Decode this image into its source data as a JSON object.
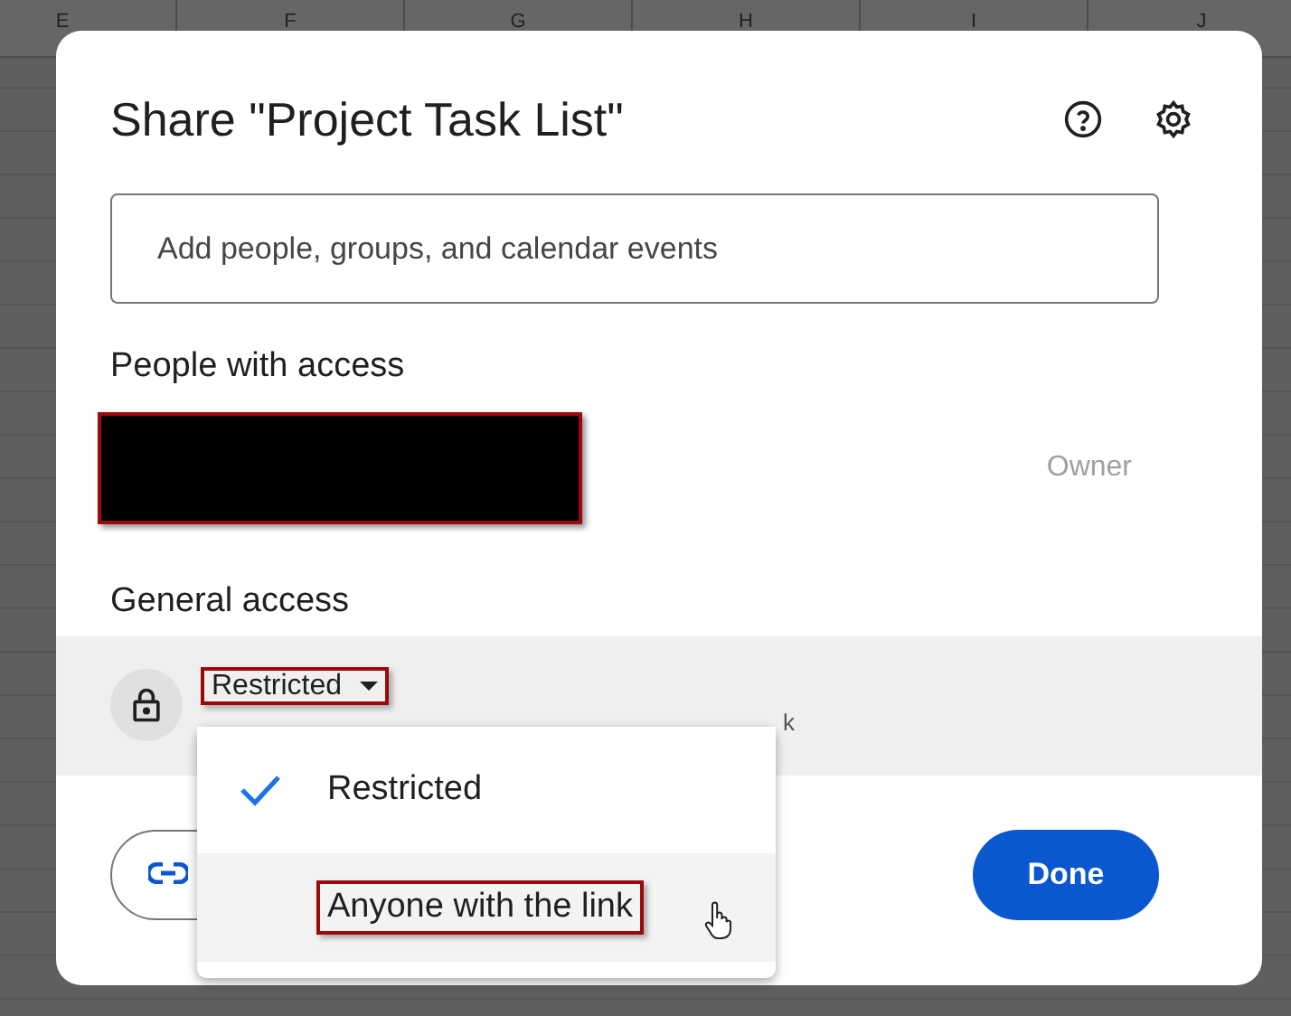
{
  "sheet": {
    "columns": [
      "E",
      "F",
      "G",
      "H",
      "I",
      "J"
    ]
  },
  "dialog": {
    "title": "Share \"Project Task List\"",
    "search": {
      "placeholder": "Add people, groups, and calendar events"
    },
    "people_heading": "People with access",
    "people": [
      {
        "role": "Owner",
        "redacted": true
      }
    ],
    "general_heading": "General access",
    "access": {
      "value": "Restricted",
      "description": "k",
      "highlighted": true
    },
    "buttons": [
      {
        "kind": "copy-link"
      },
      {
        "kind": "done",
        "label": "Done"
      }
    ]
  },
  "menu": [
    {
      "label": "Restricted",
      "selected": true,
      "hovered": false,
      "highlighted": false
    },
    {
      "label": "Anyone with the link",
      "selected": false,
      "hovered": true,
      "highlighted": true
    }
  ]
}
